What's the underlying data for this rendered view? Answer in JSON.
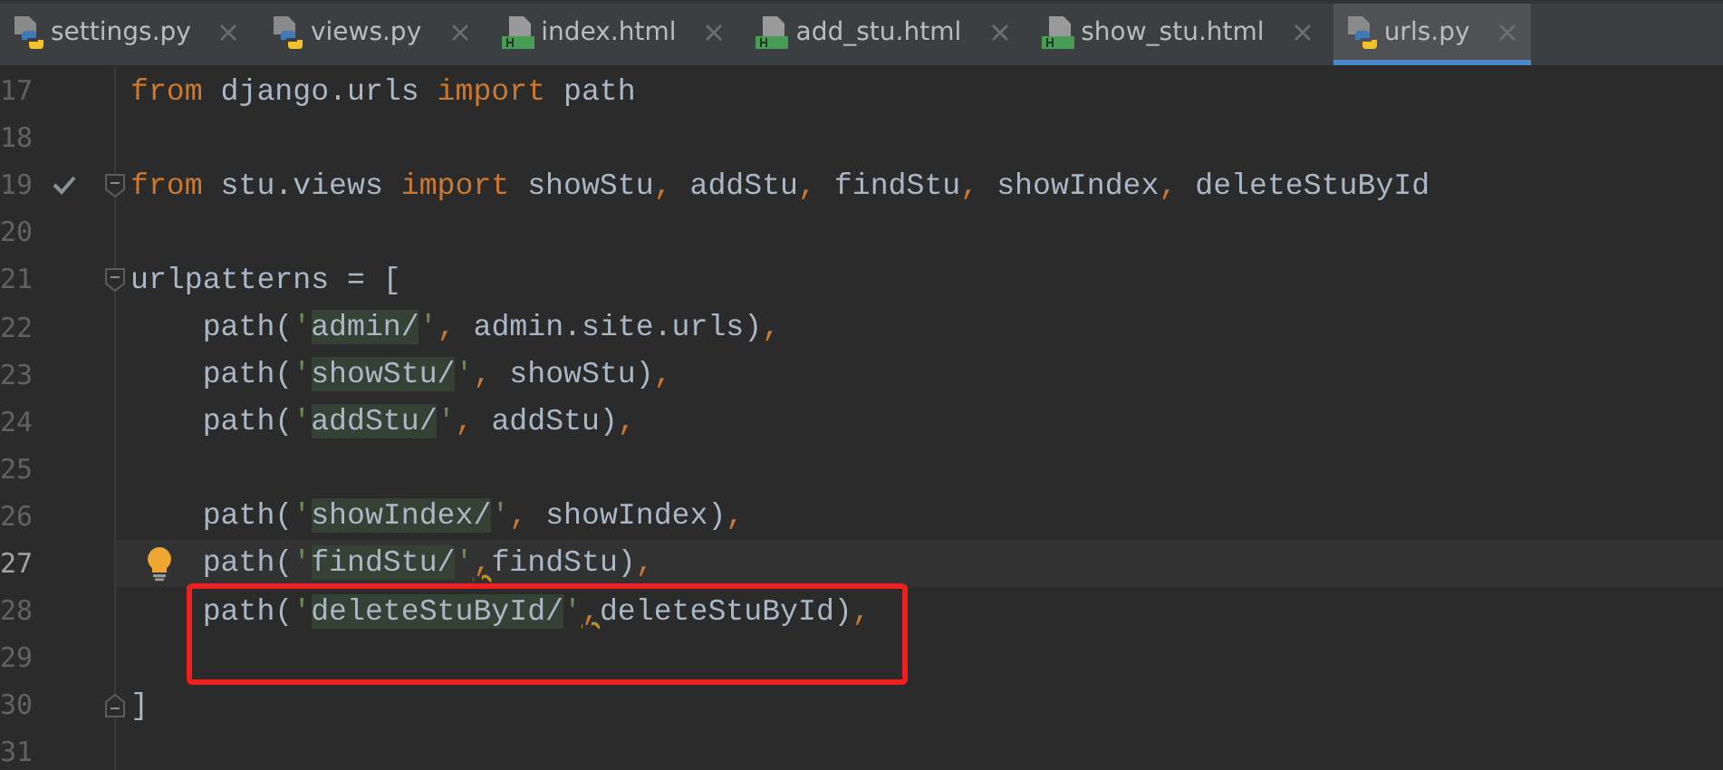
{
  "tabs": [
    {
      "label": "settings.py",
      "kind": "python",
      "selected": false
    },
    {
      "label": "views.py",
      "kind": "python",
      "selected": false
    },
    {
      "label": "index.html",
      "kind": "html",
      "selected": false
    },
    {
      "label": "add_stu.html",
      "kind": "html",
      "selected": false
    },
    {
      "label": "show_stu.html",
      "kind": "html",
      "selected": false
    },
    {
      "label": "urls.py",
      "kind": "python",
      "selected": true
    }
  ],
  "lines": [
    {
      "number": "17",
      "tokens": [
        {
          "kind": "kw",
          "text": "from"
        },
        {
          "kind": "plain",
          "text": " django.urls "
        },
        {
          "kind": "kw",
          "text": "import"
        },
        {
          "kind": "plain",
          "text": " path"
        }
      ]
    },
    {
      "number": "18"
    },
    {
      "number": "19",
      "check": true,
      "fold_start": true,
      "tokens": [
        {
          "kind": "kw",
          "text": "from"
        },
        {
          "kind": "plain",
          "text": " stu.views "
        },
        {
          "kind": "kw",
          "text": "import"
        },
        {
          "kind": "plain",
          "text": " showStu"
        },
        {
          "kind": "punct",
          "text": ","
        },
        {
          "kind": "plain",
          "text": " addStu"
        },
        {
          "kind": "punct",
          "text": ","
        },
        {
          "kind": "plain",
          "text": " findStu"
        },
        {
          "kind": "punct",
          "text": ","
        },
        {
          "kind": "plain",
          "text": " showIndex"
        },
        {
          "kind": "punct",
          "text": ","
        },
        {
          "kind": "plain",
          "text": " deleteStuById"
        }
      ]
    },
    {
      "number": "20"
    },
    {
      "number": "21",
      "fold_start": true,
      "tokens": [
        {
          "kind": "plain",
          "text": "urlpatterns = ["
        }
      ]
    },
    {
      "number": "22",
      "tokens": [
        {
          "kind": "plain",
          "text": "    path("
        },
        {
          "kind": "quote",
          "text": "'"
        },
        {
          "kind": "str",
          "text": "admin/"
        },
        {
          "kind": "quote",
          "text": "'"
        },
        {
          "kind": "punct",
          "text": ","
        },
        {
          "kind": "plain",
          "text": " admin.site.urls)"
        },
        {
          "kind": "punct",
          "text": ","
        }
      ]
    },
    {
      "number": "23",
      "tokens": [
        {
          "kind": "plain",
          "text": "    path("
        },
        {
          "kind": "quote",
          "text": "'"
        },
        {
          "kind": "str",
          "text": "showStu/"
        },
        {
          "kind": "quote",
          "text": "'"
        },
        {
          "kind": "punct",
          "text": ","
        },
        {
          "kind": "plain",
          "text": " showStu)"
        },
        {
          "kind": "punct",
          "text": ","
        }
      ]
    },
    {
      "number": "24",
      "tokens": [
        {
          "kind": "plain",
          "text": "    path("
        },
        {
          "kind": "quote",
          "text": "'"
        },
        {
          "kind": "str",
          "text": "addStu/"
        },
        {
          "kind": "quote",
          "text": "'"
        },
        {
          "kind": "punct",
          "text": ","
        },
        {
          "kind": "plain",
          "text": " addStu)"
        },
        {
          "kind": "punct",
          "text": ","
        }
      ]
    },
    {
      "number": "25"
    },
    {
      "number": "26",
      "tokens": [
        {
          "kind": "plain",
          "text": "    path("
        },
        {
          "kind": "quote",
          "text": "'"
        },
        {
          "kind": "str",
          "text": "showIndex/"
        },
        {
          "kind": "quote",
          "text": "'"
        },
        {
          "kind": "punct",
          "text": ","
        },
        {
          "kind": "plain",
          "text": " showIndex)"
        },
        {
          "kind": "punct",
          "text": ","
        }
      ]
    },
    {
      "number": "27",
      "current": true,
      "bulb": true,
      "tokens": [
        {
          "kind": "plain",
          "text": "    path("
        },
        {
          "kind": "quote",
          "text": "'"
        },
        {
          "kind": "str",
          "text": "findStu/"
        },
        {
          "kind": "quote",
          "text": "'"
        },
        {
          "kind": "warn",
          "text": ","
        },
        {
          "kind": "plain",
          "text": "findStu)"
        },
        {
          "kind": "punct",
          "text": ","
        }
      ]
    },
    {
      "number": "28",
      "boxed": true,
      "tokens": [
        {
          "kind": "plain",
          "text": "    path("
        },
        {
          "kind": "quote",
          "text": "'"
        },
        {
          "kind": "str",
          "text": "deleteStuById/"
        },
        {
          "kind": "quote",
          "text": "'"
        },
        {
          "kind": "warn",
          "text": ","
        },
        {
          "kind": "plain",
          "text": "deleteStuById)"
        },
        {
          "kind": "punct",
          "text": ","
        }
      ]
    },
    {
      "number": "29",
      "boxed": true
    },
    {
      "number": "30",
      "fold_end": true,
      "tokens": [
        {
          "kind": "plain",
          "text": "]"
        }
      ]
    },
    {
      "number": "31"
    }
  ]
}
